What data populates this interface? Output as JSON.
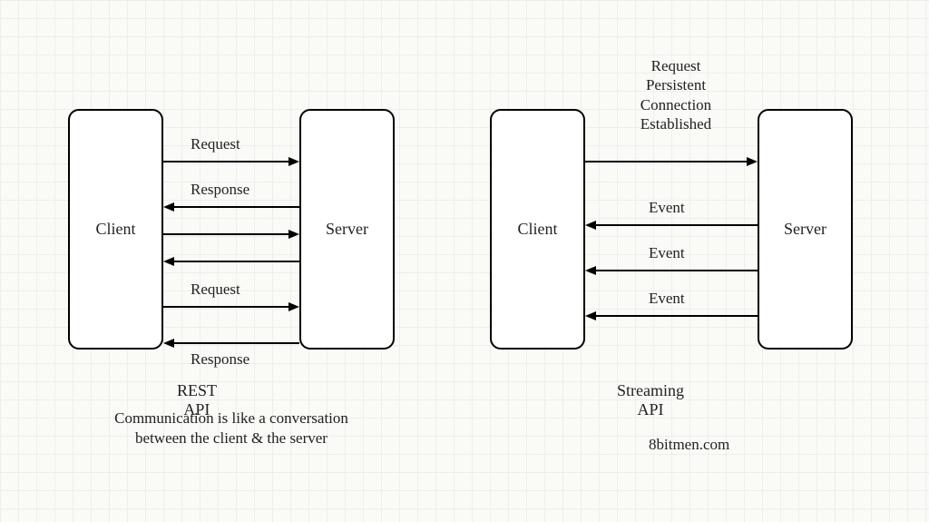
{
  "left": {
    "client": "Client",
    "server": "Server",
    "arrows": {
      "a1": "Request",
      "a2": "Response",
      "a3": "Request",
      "a4": "Response"
    },
    "title": "REST API",
    "caption": "Communication is like a\nconversation between the client &\nthe server"
  },
  "right": {
    "client": "Client",
    "server": "Server",
    "top_label": "Request\nPersistent\nConnection\nEstablished",
    "arrows": {
      "e1": "Event",
      "e2": "Event",
      "e3": "Event"
    },
    "title": "Streaming API"
  },
  "attribution": "8bitmen.com"
}
